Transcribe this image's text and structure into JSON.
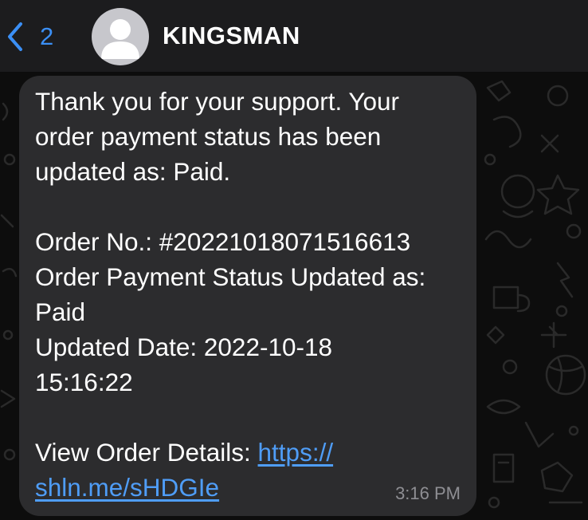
{
  "header": {
    "back_count": "2",
    "contact_name": "KINGSMAN"
  },
  "icons": {
    "back": "chevron-left-icon",
    "avatar": "person-silhouette-icon"
  },
  "colors": {
    "accent": "#3b8ff5",
    "link": "#4f9df7",
    "bubble": "#2c2c2e",
    "header": "#1c1c1e",
    "timestamp": "#8e8e93"
  },
  "message": {
    "intro_lines": [
      "Thank you for your support. Your",
      "order payment status has been",
      "updated as: Paid."
    ],
    "order_no": "Order No.: #20221018071516613",
    "status_line1": "Order Payment Status Updated as:",
    "status_line2": "Paid",
    "updated_line1": "Updated Date: 2022-10-18",
    "updated_line2": "15:16:22",
    "view_label": "View Order Details: ",
    "link_part1": "https://",
    "link_part2": "shln.me/sHDGIe",
    "time": "3:16 PM"
  }
}
